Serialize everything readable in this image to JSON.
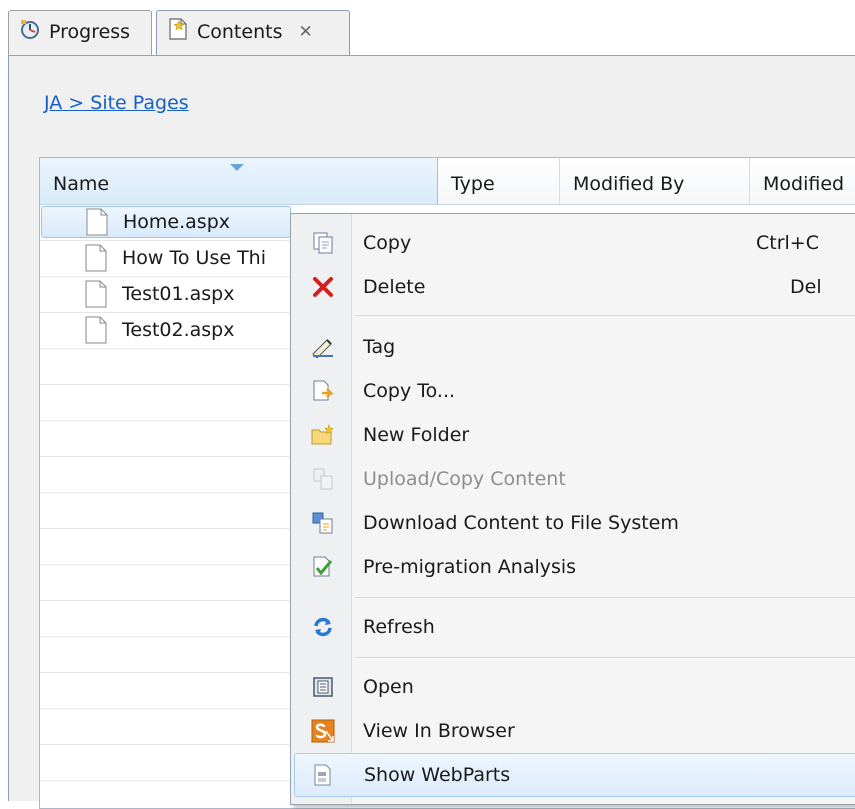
{
  "tabs": [
    {
      "label": "Progress"
    },
    {
      "label": "Contents",
      "close": "✕"
    }
  ],
  "breadcrumb": "JA > Site Pages",
  "table": {
    "columns": [
      "Name",
      "Type",
      "Modified By",
      "Modified"
    ],
    "rows": [
      {
        "name": "Home.aspx"
      },
      {
        "name": "How To Use Thi"
      },
      {
        "name": "Test01.aspx"
      },
      {
        "name": "Test02.aspx"
      }
    ]
  },
  "context_menu": {
    "copy": {
      "label": "Copy",
      "shortcut": "Ctrl+C"
    },
    "delete": {
      "label": "Delete",
      "shortcut": "Del"
    },
    "tag": {
      "label": "Tag"
    },
    "copy_to": {
      "label": "Copy To..."
    },
    "new_folder": {
      "label": "New Folder"
    },
    "upload": {
      "label": "Upload/Copy Content"
    },
    "download": {
      "label": "Download Content to File System"
    },
    "premigration": {
      "label": "Pre-migration Analysis"
    },
    "refresh": {
      "label": "Refresh"
    },
    "open": {
      "label": "Open"
    },
    "view_in_browser": {
      "label": "View In Browser"
    },
    "show_webparts": {
      "label": "Show WebParts"
    }
  },
  "colors": {
    "link": "#1560c8",
    "selection": "#d8eafb",
    "delete_red": "#d42020"
  }
}
